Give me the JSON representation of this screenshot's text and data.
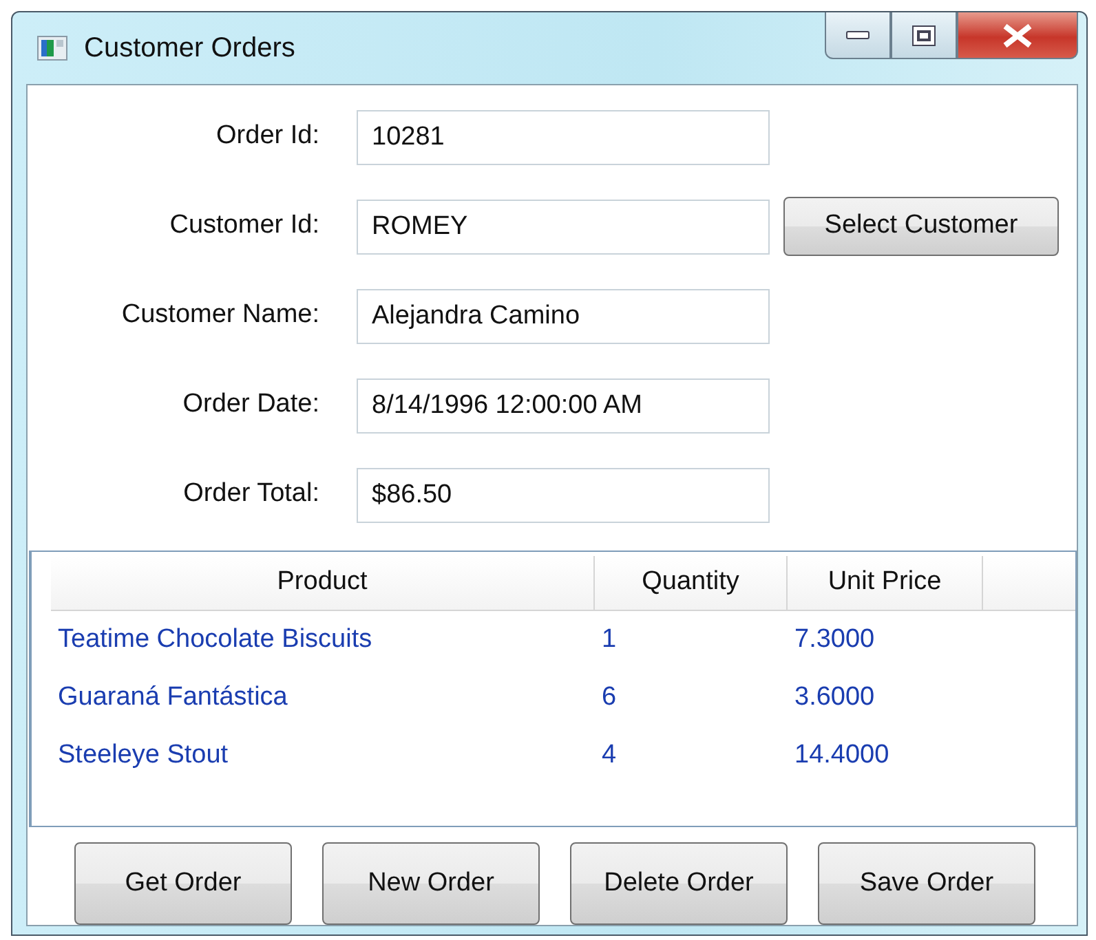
{
  "window": {
    "title": "Customer Orders"
  },
  "fields": [
    {
      "label": "Order Id:",
      "value": "10281"
    },
    {
      "label": "Customer Id:",
      "value": "ROMEY",
      "button": "Select Customer"
    },
    {
      "label": "Customer Name:",
      "value": "Alejandra Camino"
    },
    {
      "label": "Order Date:",
      "value": "8/14/1996 12:00:00 AM"
    },
    {
      "label": "Order Total:",
      "value": "$86.50"
    }
  ],
  "table": {
    "columns": [
      "Product",
      "Quantity",
      "Unit Price"
    ],
    "rows": [
      [
        "Teatime Chocolate Biscuits",
        "1",
        "7.3000"
      ],
      [
        "Guaraná Fantástica",
        "6",
        "3.6000"
      ],
      [
        "Steeleye Stout",
        "4",
        "14.4000"
      ]
    ]
  },
  "buttons": [
    "Get Order",
    "New Order",
    "Delete Order",
    "Save Order"
  ]
}
